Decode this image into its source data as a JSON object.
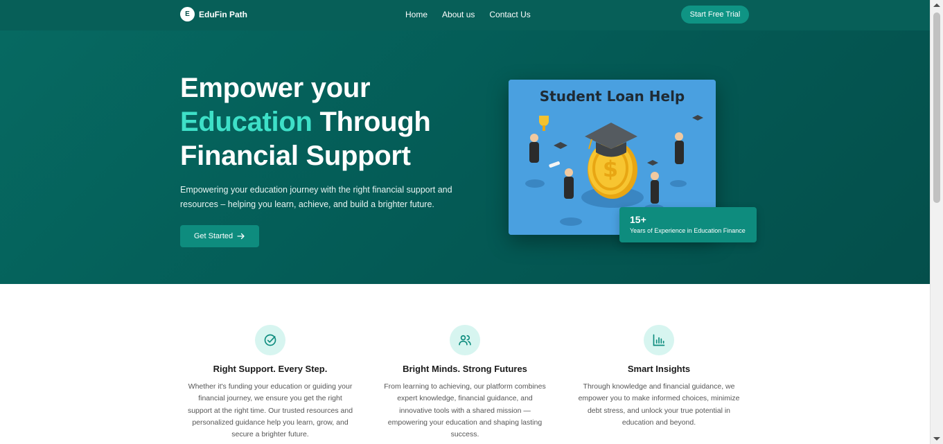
{
  "navbar": {
    "brand_initial": "E",
    "brand_name": "EduFin Path",
    "links": [
      "Home",
      "About us",
      "Contact Us"
    ],
    "cta": "Start Free Trial"
  },
  "hero": {
    "title_line1": "Empower your",
    "title_accent": "Education",
    "title_line2_rest": " Through",
    "title_line3": "Financial Support",
    "subtitle": "Empowering your education journey with the right financial support and resources – helping you learn, achieve, and build a brighter future.",
    "button_label": "Get Started",
    "button_icon": "arrow-right-icon",
    "image_title": "Student Loan Help",
    "stat_value": "15+",
    "stat_label": "Years of Experience in Education Finance"
  },
  "features": [
    {
      "icon": "check-circle-icon",
      "title": "Right Support. Every Step.",
      "desc": "Whether it's funding your education or guiding your financial journey, we ensure you get the right support at the right time. Our trusted resources and personalized guidance help you learn, grow, and secure a brighter future."
    },
    {
      "icon": "users-icon",
      "title": "Bright Minds. Strong Futures",
      "desc": "From learning to achieving, our platform combines expert knowledge, financial guidance, and innovative tools with a shared mission — empowering your education and shaping lasting success."
    },
    {
      "icon": "bar-chart-icon",
      "title": "Smart Insights",
      "desc": "Through knowledge and financial guidance, we empower you to make informed choices, minimize debt stress, and unlock your true potential in education and beyond."
    }
  ],
  "colors": {
    "primary": "#0e8c7e",
    "hero_bg": "#045a55",
    "accent": "#3ee0c8",
    "icon_bg": "#d7f5f0"
  }
}
